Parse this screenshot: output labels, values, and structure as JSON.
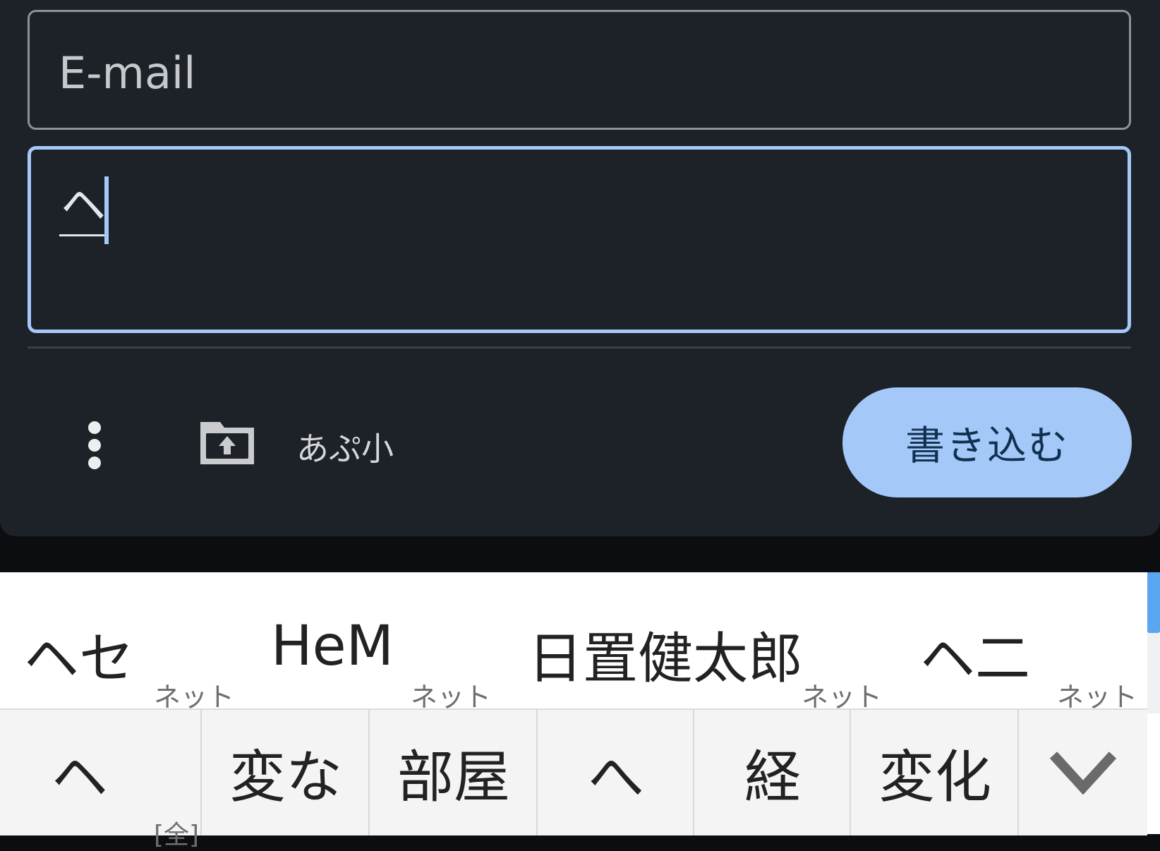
{
  "form": {
    "email_placeholder": "E-mail",
    "message_composing_text": "ヘ"
  },
  "toolbar": {
    "file_label": "あぷ小",
    "submit_label": "書き込む"
  },
  "keyboard": {
    "candidates": [
      {
        "text": "ヘセ",
        "tag": "ネット"
      },
      {
        "text": "HeM",
        "tag": "ネット"
      },
      {
        "text": "日置健太郎",
        "tag": "ネット"
      },
      {
        "text": "ヘ二",
        "tag": "ネット"
      }
    ],
    "keys": [
      "ヘ",
      "変な",
      "部屋",
      "へ",
      "経",
      "変化"
    ],
    "full_width_badge": "[全]"
  },
  "colors": {
    "panel_bg": "#1d2128",
    "accent": "#a4c9f8",
    "keyboard_bg": "#ffffff"
  },
  "icons": [
    "more-vert-icon",
    "upload-folder-icon",
    "chevron-down-icon"
  ]
}
